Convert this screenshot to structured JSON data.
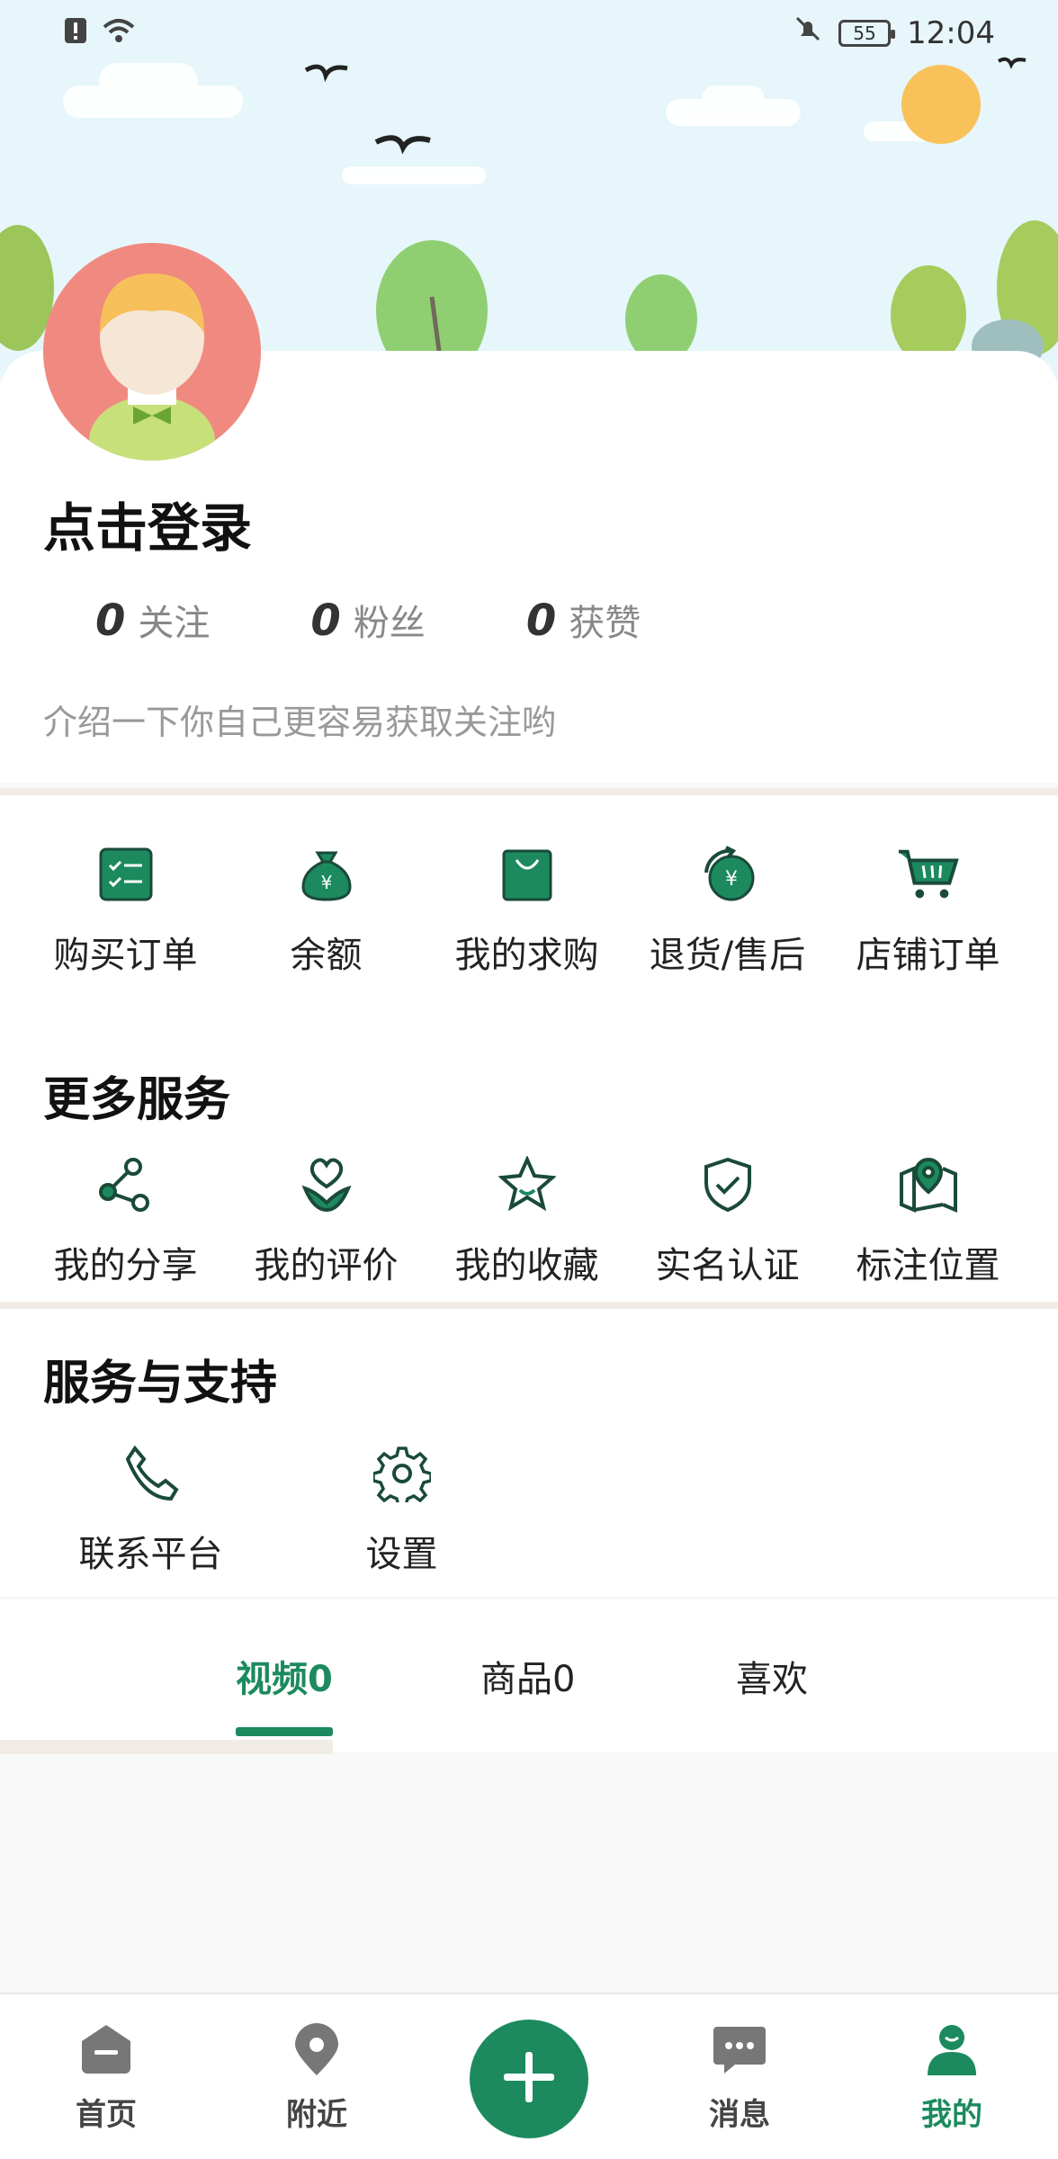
{
  "status_bar": {
    "time": "12:04",
    "battery": "55"
  },
  "profile": {
    "login_label": "点击登录",
    "stats": [
      {
        "count": "0",
        "label": "关注"
      },
      {
        "count": "0",
        "label": "粉丝"
      },
      {
        "count": "0",
        "label": "获赞"
      }
    ],
    "intro": "介绍一下你自己更容易获取关注哟"
  },
  "orders": {
    "items": [
      {
        "label": "购买订单",
        "icon": "checklist-icon"
      },
      {
        "label": "余额",
        "icon": "money-bag-icon"
      },
      {
        "label": "我的求购",
        "icon": "shopping-bag-icon"
      },
      {
        "label": "退货/售后",
        "icon": "refund-icon"
      },
      {
        "label": "店铺订单",
        "icon": "cart-icon"
      }
    ]
  },
  "more_services": {
    "title": "更多服务",
    "items": [
      {
        "label": "我的分享",
        "icon": "share-icon"
      },
      {
        "label": "我的评价",
        "icon": "heart-review-icon"
      },
      {
        "label": "我的收藏",
        "icon": "star-icon"
      },
      {
        "label": "实名认证",
        "icon": "shield-check-icon"
      },
      {
        "label": "标注位置",
        "icon": "map-pin-icon"
      }
    ]
  },
  "support": {
    "title": "服务与支持",
    "items": [
      {
        "label": "联系平台",
        "icon": "phone-icon"
      },
      {
        "label": "设置",
        "icon": "gear-icon"
      }
    ]
  },
  "tabs": [
    {
      "label": "视频0",
      "active": true
    },
    {
      "label": "商品0",
      "active": false
    },
    {
      "label": "喜欢",
      "active": false
    }
  ],
  "bottom_nav": [
    {
      "label": "首页",
      "icon": "home-icon"
    },
    {
      "label": "附近",
      "icon": "location-icon"
    },
    {
      "label": "",
      "icon": "plus-icon"
    },
    {
      "label": "消息",
      "icon": "message-icon"
    },
    {
      "label": "我的",
      "icon": "user-icon",
      "active": true
    }
  ],
  "colors": {
    "accent": "#1c8a5e",
    "avatar_bg": "#f08a80"
  }
}
